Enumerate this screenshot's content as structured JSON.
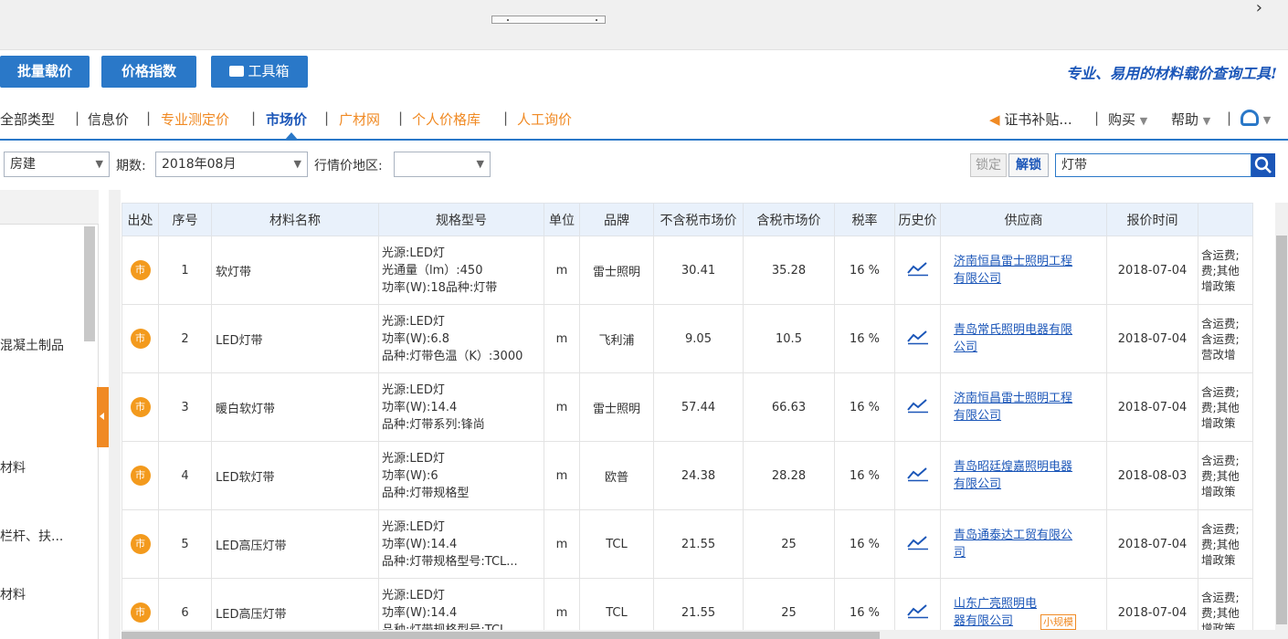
{
  "toolbar": {
    "batch_label": "批量载价",
    "index_label": "价格指数",
    "toolbox_label": "工具箱",
    "slogan": "专业、易用的材料载价查询工具!"
  },
  "nav": {
    "items": [
      {
        "label": "全部类型",
        "color": "#333333"
      },
      {
        "label": "信息价",
        "color": "#333333"
      },
      {
        "label": "专业测定价",
        "color": "#f08a24"
      },
      {
        "label": "市场价",
        "color": "#1b56b8"
      },
      {
        "label": "广材网",
        "color": "#f08a24"
      },
      {
        "label": "个人价格库",
        "color": "#f08a24"
      },
      {
        "label": "人工询价",
        "color": "#f08a24"
      }
    ],
    "right": {
      "cert_label": "证书补贴...",
      "buy_label": "购买",
      "help_label": "帮助"
    }
  },
  "filters": {
    "category": "房建",
    "period_label": "期数:",
    "period_value": "2018年08月",
    "region_label": "行情价地区:",
    "region_value": "",
    "lock_label": "锁定",
    "unlock_label": "解锁",
    "search_value": "灯带"
  },
  "left_panel": {
    "items": [
      "混凝土制品",
      "材料",
      "栏杆、扶...",
      "材料"
    ]
  },
  "table": {
    "headers": [
      "出处",
      "序号",
      "材料名称",
      "规格型号",
      "单位",
      "品牌",
      "不含税市场价",
      "含税市场价",
      "税率",
      "历史价",
      "供应商",
      "报价时间",
      ""
    ],
    "source_mark": "市",
    "rows": [
      {
        "no": "1",
        "name": "软灯带",
        "spec": [
          "光源:LED灯",
          "光通量（lm）:450",
          "功率(W):18品种:灯带"
        ],
        "unit": "m",
        "brand": "雷士照明",
        "price_ex": "30.41",
        "price_in": "35.28",
        "tax": "16 %",
        "supplier": [
          "济南恒昌雷士照明工程",
          "有限公司"
        ],
        "badge": "",
        "date": "2018-07-04",
        "note": [
          "含运费;",
          "费;其他",
          "增政策"
        ]
      },
      {
        "no": "2",
        "name": "LED灯带",
        "spec": [
          "光源:LED灯",
          "功率(W):6.8",
          "品种:灯带色温（K）:3000"
        ],
        "unit": "m",
        "brand": "飞利浦",
        "price_ex": "9.05",
        "price_in": "10.5",
        "tax": "16 %",
        "supplier": [
          "青岛常氏照明电器有限",
          "公司"
        ],
        "badge": "",
        "date": "2018-07-04",
        "note": [
          "含运费;",
          "含运费;",
          "营改增"
        ]
      },
      {
        "no": "3",
        "name": "暖白软灯带",
        "spec": [
          "光源:LED灯",
          "功率(W):14.4",
          "品种:灯带系列:锋尚"
        ],
        "unit": "m",
        "brand": "雷士照明",
        "price_ex": "57.44",
        "price_in": "66.63",
        "tax": "16 %",
        "supplier": [
          "济南恒昌雷士照明工程",
          "有限公司"
        ],
        "badge": "",
        "date": "2018-07-04",
        "note": [
          "含运费;",
          "费;其他",
          "增政策"
        ]
      },
      {
        "no": "4",
        "name": "LED软灯带",
        "spec": [
          "光源:LED灯",
          "功率(W):6",
          "品种:灯带规格型"
        ],
        "unit": "m",
        "brand": "欧普",
        "price_ex": "24.38",
        "price_in": "28.28",
        "tax": "16 %",
        "supplier": [
          "青岛昭廷煌嘉照明电器",
          "有限公司"
        ],
        "badge": "",
        "date": "2018-08-03",
        "note": [
          "含运费;",
          "费;其他",
          "增政策"
        ]
      },
      {
        "no": "5",
        "name": "LED高压灯带",
        "spec": [
          "光源:LED灯",
          "功率(W):14.4",
          "品种:灯带规格型号:TCL..."
        ],
        "unit": "m",
        "brand": "TCL",
        "price_ex": "21.55",
        "price_in": "25",
        "tax": "16 %",
        "supplier": [
          "青岛通泰达工贸有限公",
          "司"
        ],
        "badge": "",
        "date": "2018-07-04",
        "note": [
          "含运费;",
          "费;其他",
          "增政策"
        ]
      },
      {
        "no": "6",
        "name": "LED高压灯带",
        "spec": [
          "光源:LED灯",
          "功率(W):14.4",
          "品种:灯带规格型号:TCL"
        ],
        "unit": "m",
        "brand": "TCL",
        "price_ex": "21.55",
        "price_in": "25",
        "tax": "16 %",
        "supplier": [
          "山东广亮照明电",
          "器有限公司"
        ],
        "badge": "小规模",
        "date": "2018-07-04",
        "note": [
          "含运费;",
          "费;其他",
          "增政策"
        ]
      }
    ]
  },
  "colors": {
    "accent": "#2a78c8",
    "link": "#1b56b8",
    "orange": "#f08a24"
  }
}
